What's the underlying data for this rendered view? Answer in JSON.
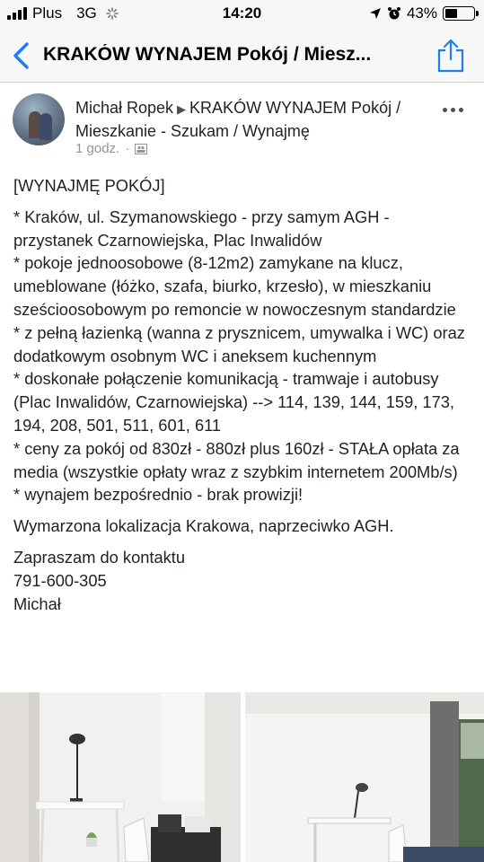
{
  "status_bar": {
    "carrier": "Plus",
    "network": "3G",
    "time": "14:20",
    "battery": "43%",
    "battery_level": 0.43
  },
  "nav": {
    "title": "KRAKÓW WYNAJEM Pokój / Miesz..."
  },
  "post": {
    "author": "Michał Ropek",
    "group": "KRAKÓW WYNAJEM Pokój / Mieszkanie - Szukam / Wynajmę",
    "time": "1 godz.",
    "time_separator": "·",
    "heading": "[WYNAJMĘ POKÓJ]",
    "bullets": [
      "* Kraków, ul. Szymanowskiego - przy samym AGH - przystanek Czarnowiejska, Plac Inwalidów",
      "* pokoje jednoosobowe (8-12m2) zamykane na klucz, umeblowane (łóżko, szafa, biurko, krzesło), w mieszkaniu sześcioosobowym po remoncie w nowoczesnym standardzie",
      "* z pełną łazienką (wanna z prysznicem, umywalka i WC) oraz dodatkowym osobnym WC i aneksem kuchennym",
      "* doskonałe połączenie komunikacją - tramwaje i autobusy (Plac Inwalidów, Czarnowiejska) --> 114, 139, 144, 159, 173, 194, 208, 501, 511, 601, 611",
      "* ceny za pokój od 830zł - 880zł plus 160zł - STAŁA opłata za media (wszystkie opłaty wraz z szybkim internetem 200Mb/s)",
      "* wynajem bezpośrednio - brak prowizji!"
    ],
    "location_note": "Wymarzona lokalizacja Krakowa, naprzeciwko AGH.",
    "contact_line": "Zapraszam do kontaktu",
    "phone": "791-600-305",
    "signature": "Michał"
  },
  "icons": {
    "back": "chevron-left-icon",
    "share": "share-icon",
    "more": "more-horizontal-icon",
    "audience": "group-audience-icon",
    "location": "location-arrow-icon",
    "alarm": "alarm-clock-icon"
  },
  "colors": {
    "accent": "#1b7ef2",
    "text": "#1d2129",
    "meta": "#90949c"
  }
}
